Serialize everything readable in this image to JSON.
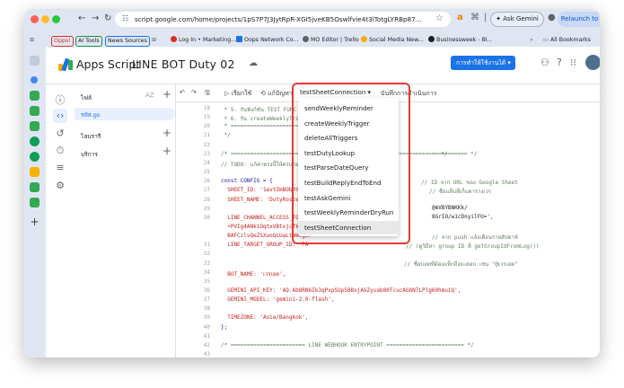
{
  "browser": {
    "url": "script.google.com/home/projects/1pS7P7J3JytRpR-XGI5jveKB5Oswlfvie4t3lTotgLYRBp87...",
    "ask_gemini": "Ask Gemini",
    "relaunch": "Relaunch to update"
  },
  "bookmarks": {
    "items": [
      "Opps!",
      "AI Tools",
      "News Sources",
      "Log In • Marketing...",
      "Oops Network Co...",
      "MO Editor | Trello",
      "Social Media New...",
      "Businessweek - Bl...",
      "All Bookmarks"
    ]
  },
  "header": {
    "app_name": "Apps Script",
    "project_name": "LINE BOT Duty 02",
    "deploy_label": "การทำให้ใช้งานได้"
  },
  "files": {
    "header": "ไฟล์",
    "sort": "AZ",
    "file": "รหัส.gs",
    "libraries": "ไลบรารี",
    "services": "บริการ"
  },
  "toolbar": {
    "run": "เรียกใช้",
    "debug": "แก้ปัญหา",
    "function": "testSheetConnection",
    "execution_log": "บันทึกการดำเนินการ"
  },
  "dropdown": {
    "items": [
      "sendWeeklyReminder",
      "createWeeklyTrigger",
      "deleteAllTriggers",
      "testDutyLookup",
      "testParseDateQuery",
      "testBuildReplyEndToEnd",
      "testAskGemini",
      "testWeeklyReminderDryRun",
      "testSheetConnection"
    ],
    "selected": "testSheetConnection"
  },
  "code": {
    "line_numbers": [
      "18",
      "19",
      "20",
      "21",
      "22",
      "23",
      "24",
      "25",
      "26",
      "27",
      "28",
      "29",
      "30",
      "",
      "",
      "31",
      "32",
      "33",
      "34",
      "35",
      "36",
      "37",
      "38",
      "39",
      "40",
      "41",
      "42",
      "43",
      "44",
      "45",
      "46"
    ],
    "lines": [
      " * 5. รันฟังก์ชัน TEST FUNC",
      " * 6. รัน createWeeklyTrigger()",
      " * =====================================",
      " */",
      "",
      "/* ========================================================================= */",
      "// TODO: แก้ค่าตรงนี้ให้ครบก่อนใช้งาน",
      "",
      "const CONFIG = {",
      "  SHEET_ID: '1evtZmBOb0YrY0S8",
      "  SHEET_NAME: 'DutyRoster',",
      "",
      "  LINE_CHANNEL_ACCESS_TOKEN:",
      "  +PVIg4ANk1OqtxVBtxjcfkn9hI",
      "  BAFCzlvQeZSXuoQLUaLtmWeg5P",
      "  LINE_TARGET_GROUP_ID: 'PA",
      "",
      "",
      "  BOT_NAME: 'เวรเอด',",
      "",
      "  GEMINI_API_KEY: 'AQ.Ab8RN6Ik3qPxpSUp58BxjAkZyvab80TcucAGbN7LPlg69hmuiQ',",
      "  GEMINI_MODEL: 'gemini-2.0-flash',",
      "",
      "  TIMEZONE: 'Asia/Bangkok',",
      "};",
      "",
      "/* ======================= LINE WEBHOOK ENTRYPOINT ======================== */",
      "",
      "/**",
      " * รับ Webhook จาก LINE Messaging API",
      " */"
    ],
    "right_annotations": [
      "// ID จาก URL ของ Google Sheet",
      "// ชื่อแท็บที่เก็บตารางเวร",
      "// จาก push แจ้งเตือนรายสัปดาห์",
      "// (ดูวิธีหา group ID ที่ getGroupIdFromLog())",
      "// ชื่อบอทที่ต้องแท็กถึงจะตอบ เช่น \"@เวรเอด\"",
      "@mVBYBNKKk/",
      "8GrIO/w1cDnyilFU=',",
      "= */"
    ]
  }
}
